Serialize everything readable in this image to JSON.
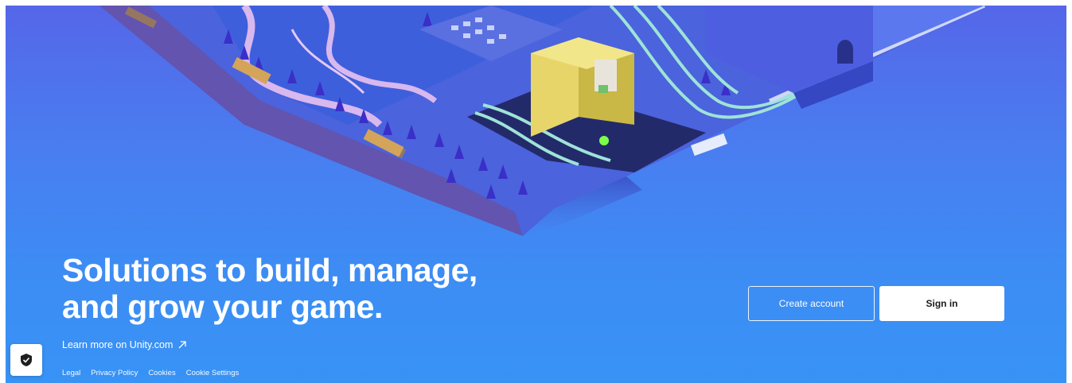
{
  "hero": {
    "headline_line1": "Solutions to build, manage,",
    "headline_line2": "and grow your game."
  },
  "links": {
    "learn_more": "Learn more on Unity.com",
    "learn_more_icon": "external-arrow-icon"
  },
  "buttons": {
    "create_account": "Create account",
    "sign_in": "Sign in"
  },
  "footer": {
    "legal": "Legal",
    "privacy_policy": "Privacy Policy",
    "cookies": "Cookies",
    "cookie_settings": "Cookie Settings"
  },
  "privacy_badge": {
    "icon": "shield-check-icon"
  },
  "colors": {
    "background_top": "#5566e8",
    "background_bottom": "#3893f5",
    "primary_button_bg": "#ffffff",
    "primary_button_text": "#1a1a1a"
  }
}
